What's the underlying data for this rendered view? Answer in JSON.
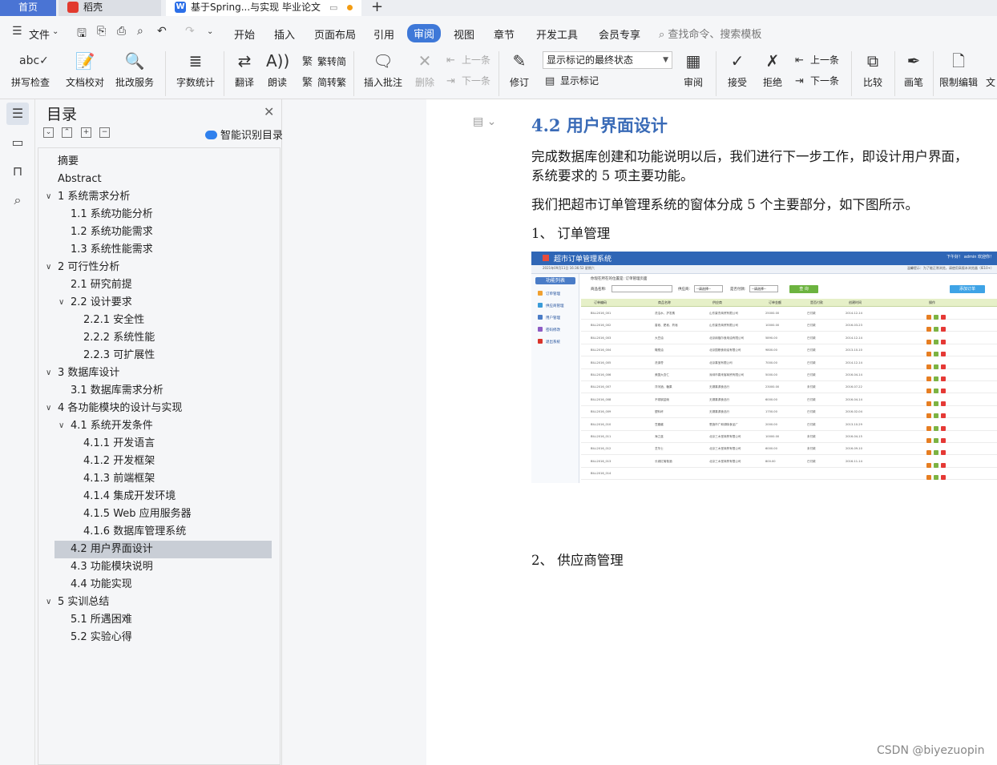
{
  "tabs": {
    "home": "首页",
    "app": "稻壳",
    "doc": "基于Spring...与实现 毕业论文"
  },
  "menu": {
    "file": "文件",
    "items": [
      "开始",
      "插入",
      "页面布局",
      "引用",
      "审阅",
      "视图",
      "章节",
      "开发工具",
      "会员专享"
    ],
    "active_index": 4,
    "search": "查找命令、搜索模板"
  },
  "ribbon": {
    "spell": "拼写检查",
    "proof": "文档校对",
    "review_service": "批改服务",
    "word_count": "字数统计",
    "translate": "翻译",
    "read_aloud": "朗读",
    "trad": "繁转简",
    "simp": "简转繁",
    "insert_comment": "插入批注",
    "delete": "删除",
    "prev_comment": "上一条",
    "next_comment": "下一条",
    "revise": "修订",
    "markup_select": "显示标记的最终状态",
    "show_markup": "显示标记",
    "review_pane": "审阅",
    "accept": "接受",
    "reject": "拒绝",
    "prev_change": "上一条",
    "next_change": "下一条",
    "compare": "比较",
    "ink": "画笔",
    "restrict": "限制编辑",
    "more": "文"
  },
  "toc": {
    "title": "目录",
    "smart": "智能识别目录",
    "items": [
      {
        "label": "摘要",
        "level": 0,
        "chev": false
      },
      {
        "label": "Abstract",
        "level": 0,
        "chev": false
      },
      {
        "label": "1 系统需求分析",
        "level": 0,
        "chev": true
      },
      {
        "label": "1.1 系统功能分析",
        "level": 1,
        "chev": false
      },
      {
        "label": "1.2 系统功能需求",
        "level": 1,
        "chev": false
      },
      {
        "label": "1.3 系统性能需求",
        "level": 1,
        "chev": false
      },
      {
        "label": "2 可行性分析",
        "level": 0,
        "chev": true
      },
      {
        "label": "2.1 研究前提",
        "level": 1,
        "chev": false
      },
      {
        "label": "2.2 设计要求",
        "level": 1,
        "chev": true
      },
      {
        "label": "2.2.1 安全性",
        "level": 2,
        "chev": false
      },
      {
        "label": "2.2.2 系统性能",
        "level": 2,
        "chev": false
      },
      {
        "label": "2.2.3 可扩展性",
        "level": 2,
        "chev": false
      },
      {
        "label": "3 数据库设计",
        "level": 0,
        "chev": true
      },
      {
        "label": "3.1 数据库需求分析",
        "level": 1,
        "chev": false
      },
      {
        "label": "4 各功能模块的设计与实现",
        "level": 0,
        "chev": true
      },
      {
        "label": "4.1 系统开发条件",
        "level": 1,
        "chev": true
      },
      {
        "label": "4.1.1 开发语言",
        "level": 2,
        "chev": false
      },
      {
        "label": "4.1.2 开发框架",
        "level": 2,
        "chev": false
      },
      {
        "label": "4.1.3 前端框架",
        "level": 2,
        "chev": false
      },
      {
        "label": "4.1.4 集成开发环境",
        "level": 2,
        "chev": false
      },
      {
        "label": "4.1.5 Web 应用服务器",
        "level": 2,
        "chev": false
      },
      {
        "label": "4.1.6 数据库管理系统",
        "level": 2,
        "chev": false
      },
      {
        "label": "4.2 用户界面设计",
        "level": 1,
        "chev": false,
        "selected": true
      },
      {
        "label": "4.3 功能模块说明",
        "level": 1,
        "chev": false
      },
      {
        "label": "4.4 功能实现",
        "level": 1,
        "chev": false
      },
      {
        "label": "5 实训总结",
        "level": 0,
        "chev": true
      },
      {
        "label": "5.1 所遇困难",
        "level": 1,
        "chev": false
      },
      {
        "label": "5.2 实验心得",
        "level": 1,
        "chev": false
      }
    ]
  },
  "doc": {
    "heading": "4.2 用户界面设计",
    "para1_line1": "完成数据库创建和功能说明以后，我们进行下一步工作，即设计用户界面，",
    "para1_line2": "系统要求的 5 项主要功能。",
    "para2": "我们把超市订单管理系统的窗体分成 5 个主要部分，如下图所示。",
    "item1": "1、 订单管理",
    "item2": "2、 供应商管理"
  },
  "screenshot": {
    "title": "超市订单管理系统",
    "user": "下午好！ admin 欢迎你！",
    "date": "2021年09月11日 16:36:52 星期六",
    "tip": "温馨提示：为了能正常浏览，请使用高版本浏览器（IE10+）",
    "side_head": "功能列表",
    "side_items": [
      {
        "label": "订单管理",
        "color": "#f0a030"
      },
      {
        "label": "供应商管理",
        "color": "#3a9bd8"
      },
      {
        "label": "用户管理",
        "color": "#4a7cc7"
      },
      {
        "label": "密码修改",
        "color": "#8e5cc4"
      },
      {
        "label": "退出系统",
        "color": "#d9342b"
      }
    ],
    "crumb": "你现在所在的位置是: 订单管理页面",
    "filter_name": "商品名称:",
    "filter_provider": "供应商:",
    "filter_paid": "是否付款:",
    "select_text": "--请选择--",
    "query": "查 询",
    "add": "添加订单",
    "headers": [
      "订单编码",
      "商品名称",
      "供应商",
      "订单金额",
      "是否付款",
      "创建时间",
      "操作"
    ],
    "rows": [
      [
        "BILL2016_001",
        "洗洁水、护发素",
        "山东豪杰商贸有限公司",
        "25000.00",
        "已付款",
        "2014-12-14"
      ],
      [
        "BILL2016_002",
        "香皂、肥皂、药皂",
        "山东豪杰商贸有限公司",
        "10000.00",
        "已付款",
        "2016-03-23"
      ],
      [
        "BILL2016_003",
        "大豆油",
        "北京纳福尔食用油有限公司",
        "5890.00",
        "已付款",
        "2014-12-14"
      ],
      [
        "BILL2016_004",
        "橄榄油",
        "北京国粮食用油有限公司",
        "9800.00",
        "已付款",
        "2013-10-10"
      ],
      [
        "BILL2016_005",
        "洗涤膏",
        "北京喜宝有限公司",
        "7000.00",
        "已付款",
        "2014-12-14"
      ],
      [
        "BILL2016_006",
        "美国大杏仁",
        "深圳市喜来客商贸有限公司",
        "5000.00",
        "已付款",
        "2016-04-14"
      ],
      [
        "BILL2016_007",
        "洋河酒、糖果",
        "无锡喜源食品行",
        "23000.00",
        "未付款",
        "2016-07-22"
      ],
      [
        "BILL2016_008",
        "不锈钢盆碗",
        "无锡喜源食品行",
        "6000.00",
        "已付款",
        "2016-04-14"
      ],
      [
        "BILL2016_009",
        "塑料杯",
        "无锡喜源食品行",
        "1750.00",
        "已付款",
        "2016-02-04"
      ],
      [
        "BILL2016_010",
        "豆瓣酱",
        "恩施市广和调味食品厂",
        "2000.00",
        "已付款",
        "2013-10-29"
      ],
      [
        "BILL2016_011",
        "海之蓝",
        "北京三木堂商贸有限公司",
        "10000.00",
        "未付款",
        "2016-04-15"
      ],
      [
        "BILL2016_012",
        "芝华士",
        "北京三木堂商贸有限公司",
        "6000.00",
        "未付款",
        "2016-09-10"
      ],
      [
        "BILL2016_013",
        "长城红葡萄酒",
        "北京三木堂商贸有限公司",
        "800.00",
        "已付款",
        "2016-11-14"
      ],
      [
        "BILL2016_014",
        "",
        "",
        "",
        "",
        ""
      ]
    ]
  },
  "watermark": "CSDN @biyezuopin"
}
